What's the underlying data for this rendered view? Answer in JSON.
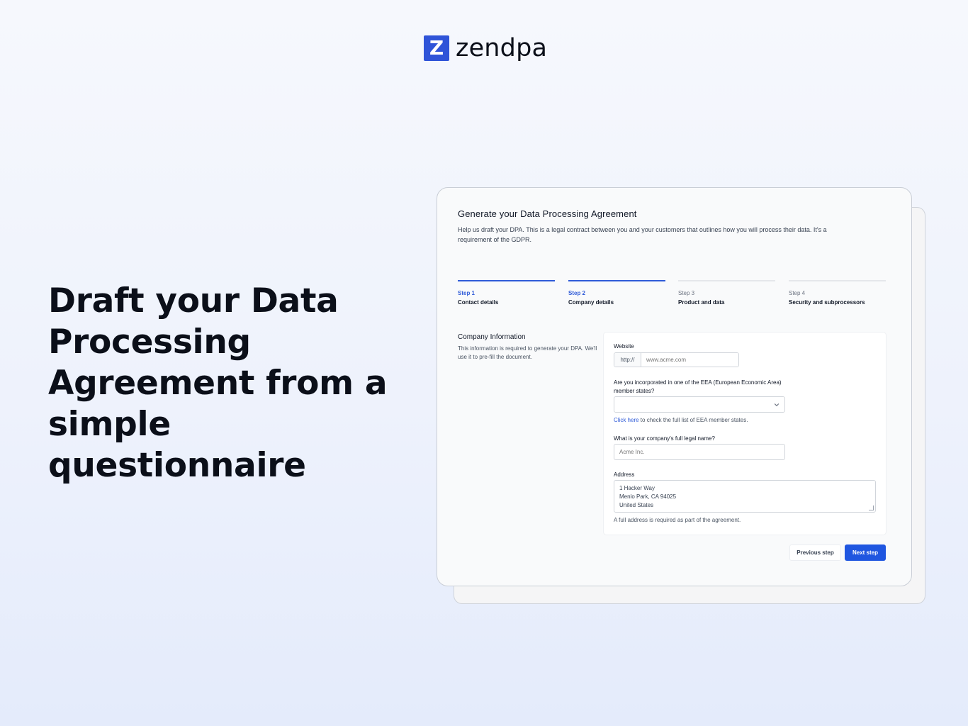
{
  "brand": {
    "logo_letter": "Z",
    "name": "zendpa",
    "accent_color": "#2f54d8"
  },
  "hero": {
    "headline": "Draft your Data Processing Agreement from a simple questionnaire"
  },
  "wizard": {
    "title": "Generate your Data Processing Agreement",
    "description": "Help us draft your DPA. This is a legal contract between you and your customers that outlines how you will process their data. It's a requirement of the GDPR.",
    "steps": [
      {
        "number": "Step 1",
        "name": "Contact details",
        "state": "complete"
      },
      {
        "number": "Step 2",
        "name": "Company details",
        "state": "current"
      },
      {
        "number": "Step 3",
        "name": "Product and data",
        "state": "upcoming"
      },
      {
        "number": "Step 4",
        "name": "Security and subprocessors",
        "state": "upcoming"
      }
    ],
    "section": {
      "title": "Company Information",
      "description": "This information is required to generate your DPA. We'll use it to pre-fill the document."
    },
    "form": {
      "website": {
        "label": "Website",
        "prefix": "http://",
        "placeholder": "www.acme.com",
        "value": ""
      },
      "eea": {
        "label": "Are you incorporated in one of the EEA (European Economic Area) member states?",
        "selected": "",
        "helper_link": "Click here",
        "helper_text": " to check the full list of EEA member states."
      },
      "legal_name": {
        "label": "What is your company's full legal name?",
        "placeholder": "Acme Inc.",
        "value": ""
      },
      "address": {
        "label": "Address",
        "value": "1 Hacker Way\nMenlo Park, CA 94025\nUnited States",
        "helper": "A full address is required as part of the agreement."
      }
    },
    "buttons": {
      "previous": "Previous step",
      "next": "Next step"
    },
    "primary_color": "#1f56e0"
  }
}
